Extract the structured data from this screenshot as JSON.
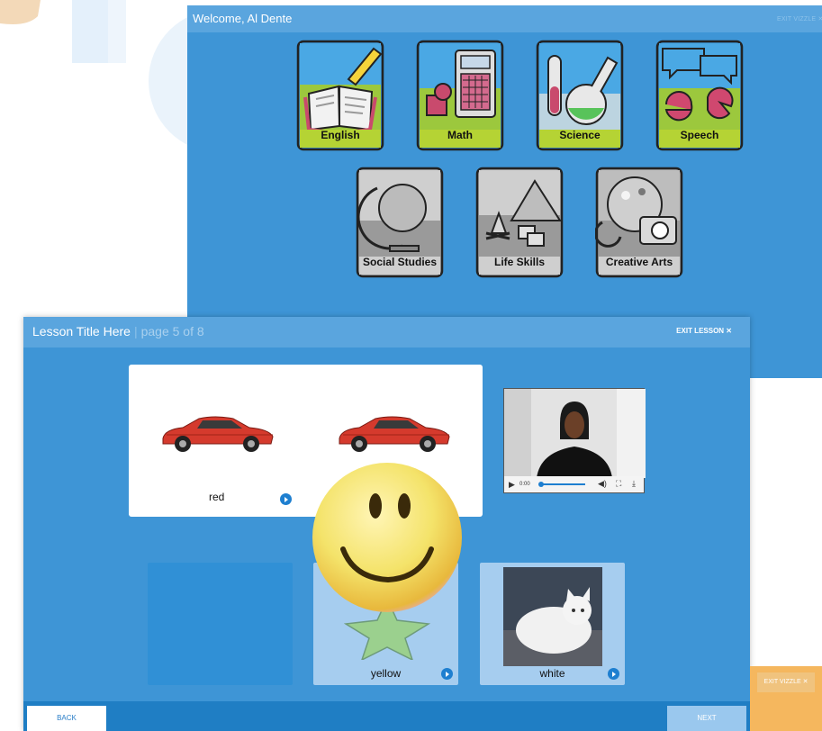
{
  "back_window": {
    "welcome": "Welcome, Al Dente",
    "exit_label": "EXIT VIZZLE ✕",
    "subjects": [
      {
        "label": "English"
      },
      {
        "label": "Math"
      },
      {
        "label": "Science"
      },
      {
        "label": "Speech"
      },
      {
        "label": "Social Studies"
      },
      {
        "label": "Life Skills"
      },
      {
        "label": "Creative Arts"
      }
    ]
  },
  "lesson": {
    "title": "Lesson Title Here",
    "separator": "|",
    "page": "page 5 of 8",
    "exit_label": "EXIT LESSON ✕",
    "prompt": {
      "word": "red"
    },
    "video": {
      "time": "0:00"
    },
    "choices": [
      {
        "word": "yellow"
      },
      {
        "word": "white"
      }
    ],
    "back_label": "BACK",
    "next_label": "NEXT"
  },
  "peek": {
    "exit_label": "EXIT VIZZLE ✕"
  },
  "colors": {
    "accent": "#3e95d6",
    "topbar": "#5aa5de",
    "tile_green": "#b5d334",
    "tile_gray": "#b8b8b8"
  }
}
